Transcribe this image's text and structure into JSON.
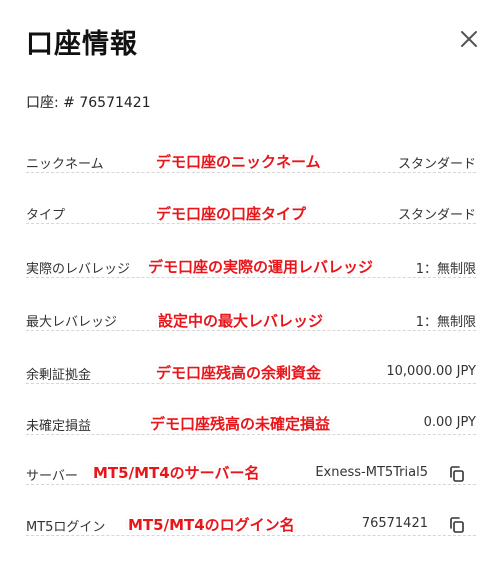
{
  "dialog": {
    "title": "口座情報",
    "account_line": "口座: # 76571421"
  },
  "rows": [
    {
      "label": "ニックネーム",
      "value": "スタンダード",
      "annotation": "デモ口座のニックネーム"
    },
    {
      "label": "タイプ",
      "value": "スタンダード",
      "annotation": "デモ口座の口座タイプ"
    },
    {
      "label": "実際のレバレッジ",
      "value": "1：無制限",
      "annotation": "デモ口座の実際の運用レバレッジ"
    },
    {
      "label": "最大レバレッジ",
      "value": "1：無制限",
      "annotation": "設定中の最大レバレッジ"
    },
    {
      "label": "余剰証拠金",
      "value": "10,000.00 JPY",
      "annotation": "デモ口座残高の余剰資金"
    },
    {
      "label": "未確定損益",
      "value": "0.00 JPY",
      "annotation": "デモ口座残高の未確定損益"
    },
    {
      "label": "サーバー",
      "value": "Exness-MT5Trial5",
      "annotation": "MT5/MT4のサーバー名"
    },
    {
      "label": "MT5ログイン",
      "value": "76571421",
      "annotation": "MT5/MT4のログイン名"
    }
  ],
  "icons": {
    "close": "close-icon",
    "copy": "copy-icon"
  },
  "colors": {
    "annotation": "#e8161b",
    "dotted_leader": "#d6d6d6"
  }
}
